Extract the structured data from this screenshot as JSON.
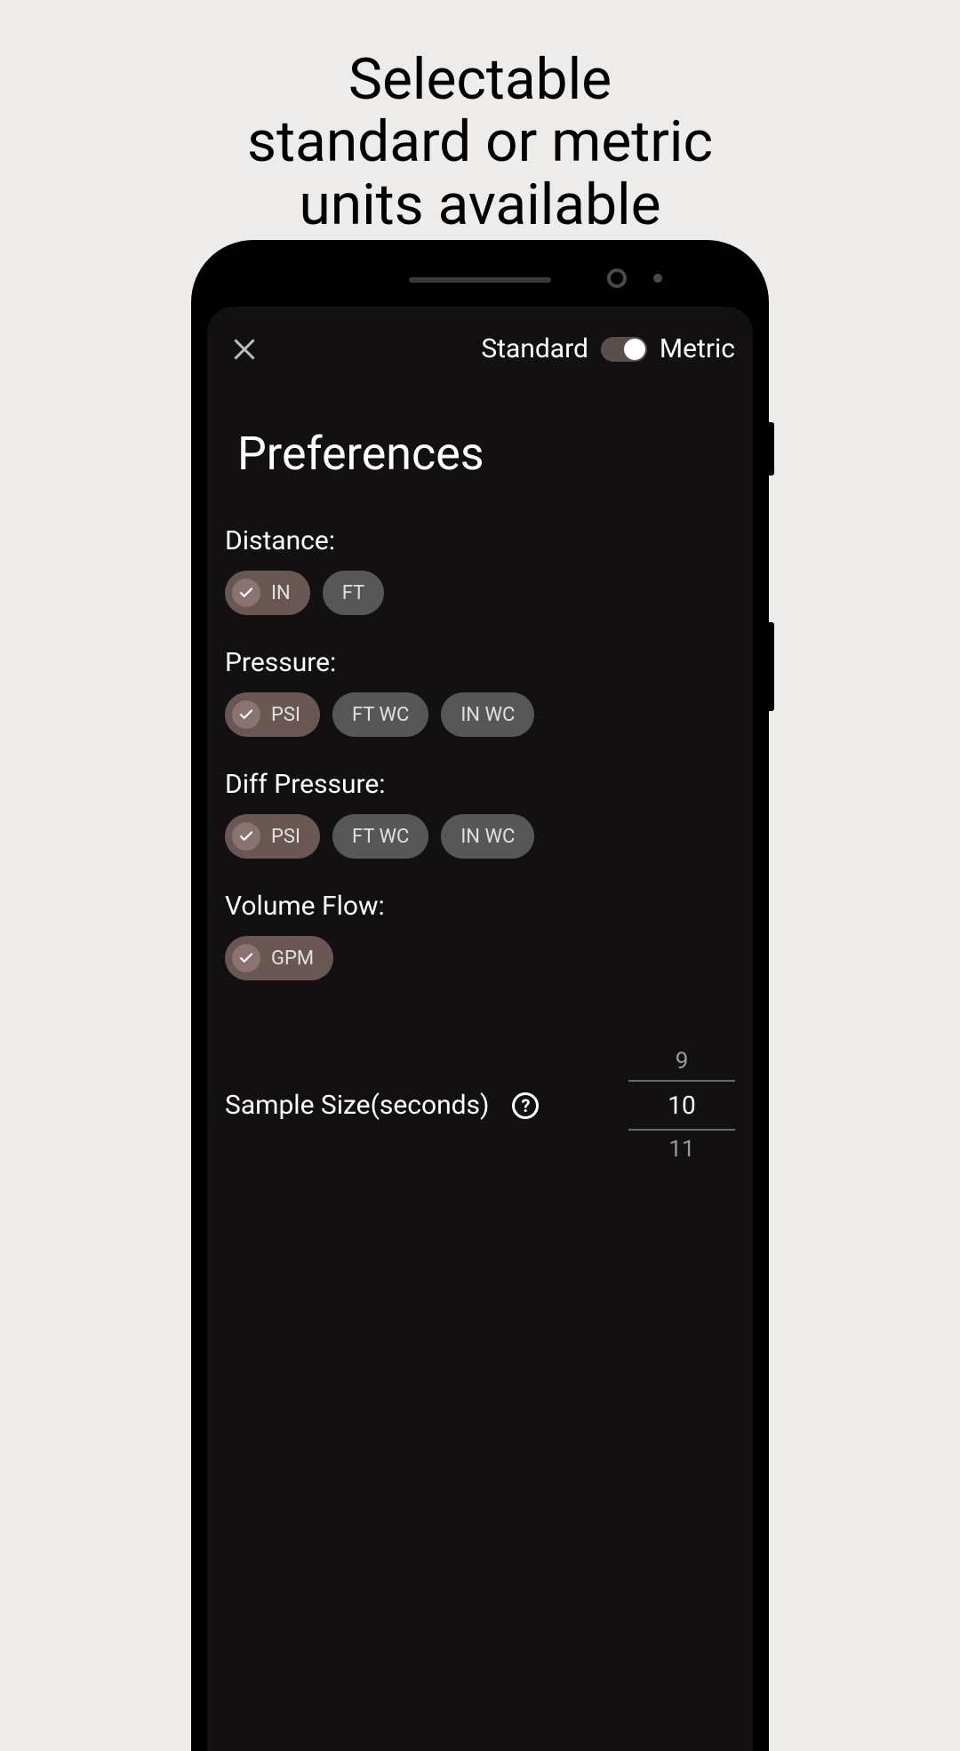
{
  "promo": {
    "line1": "Selectable",
    "line2": "standard or metric",
    "line3": "units available"
  },
  "toolbar": {
    "standard_label": "Standard",
    "metric_label": "Metric"
  },
  "title": "Preferences",
  "groups": {
    "distance": {
      "label": "Distance:",
      "options": [
        "IN",
        "FT"
      ],
      "selected": "IN"
    },
    "pressure": {
      "label": "Pressure:",
      "options": [
        "PSI",
        "FT WC",
        "IN WC"
      ],
      "selected": "PSI"
    },
    "diff_pressure": {
      "label": "Diff Pressure:",
      "options": [
        "PSI",
        "FT WC",
        "IN WC"
      ],
      "selected": "PSI"
    },
    "volume_flow": {
      "label": "Volume Flow:",
      "options": [
        "GPM"
      ],
      "selected": "GPM"
    }
  },
  "sample": {
    "label": "Sample Size(seconds)",
    "prev": "9",
    "current": "10",
    "next": "11"
  },
  "help_glyph": "?"
}
